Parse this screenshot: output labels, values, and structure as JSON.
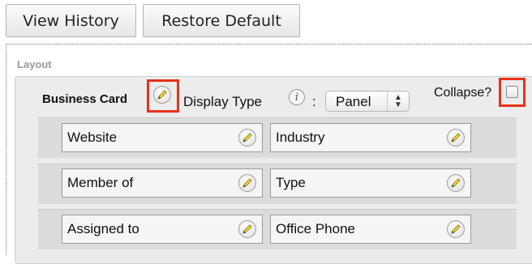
{
  "toolbar": {
    "view_history_label": "View History",
    "restore_default_label": "Restore Default"
  },
  "layout": {
    "heading": "Layout",
    "panel": {
      "title": "Business Card",
      "display_type_label": "Display Type",
      "info_icon_glyph": "i",
      "colon": ":",
      "display_type_value": "Panel",
      "collapse_label": "Collapse?",
      "collapse_checked": false
    },
    "rows": [
      {
        "left": "Website",
        "right": "Industry"
      },
      {
        "left": "Member of",
        "right": "Type"
      },
      {
        "left": "Assigned to",
        "right": "Office Phone"
      }
    ]
  },
  "icons": {
    "edit": "pencil-icon",
    "info": "info-icon",
    "select_arrows": "up-down-arrows-icon"
  },
  "colors": {
    "highlight": "#e8311a",
    "panel_bg": "#ececec",
    "row_bg": "#dcdcdc"
  }
}
